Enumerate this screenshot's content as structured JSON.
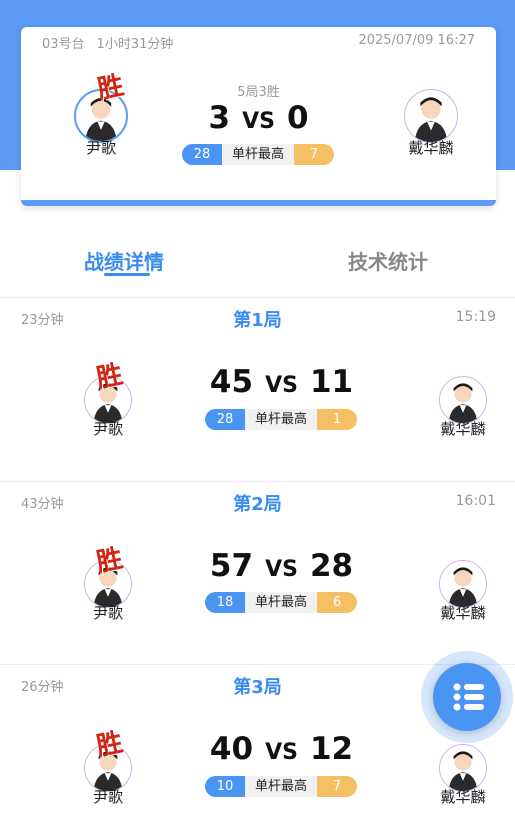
{
  "header": {
    "table": "03号台",
    "duration": "1小时31分钟",
    "datetime": "2025/07/09 16:27",
    "format": "5局3胜",
    "player1": "尹歌",
    "player2": "戴华麟",
    "score1": "3",
    "vs": "VS",
    "score2": "0",
    "win_tag": "胜",
    "break_label": "单杆最高",
    "break1": "28",
    "break2": "7"
  },
  "tabs": {
    "detail": "战绩详情",
    "stats": "技术统计"
  },
  "games": [
    {
      "title": "第1局",
      "duration": "23分钟",
      "time": "15:19",
      "p1": "尹歌",
      "p2": "戴华麟",
      "s1": "45",
      "s2": "11",
      "b1": "28",
      "b2": "1",
      "vs": "VS",
      "break_label": "单杆最高",
      "win_tag": "胜"
    },
    {
      "title": "第2局",
      "duration": "43分钟",
      "time": "16:01",
      "p1": "尹歌",
      "p2": "戴华麟",
      "s1": "57",
      "s2": "28",
      "b1": "18",
      "b2": "6",
      "vs": "VS",
      "break_label": "单杆最高",
      "win_tag": "胜"
    },
    {
      "title": "第3局",
      "duration": "26分钟",
      "time": "",
      "p1": "尹歌",
      "p2": "戴华麟",
      "s1": "40",
      "s2": "12",
      "b1": "10",
      "b2": "7",
      "vs": "VS",
      "break_label": "单杆最高",
      "win_tag": "胜"
    }
  ],
  "colors": {
    "accent": "#4a95f3",
    "win": "#d4230f",
    "break_right": "#f5c064"
  },
  "icons": {
    "fab": "list-menu-icon",
    "avatar": "cartoon-avatar-icon"
  }
}
